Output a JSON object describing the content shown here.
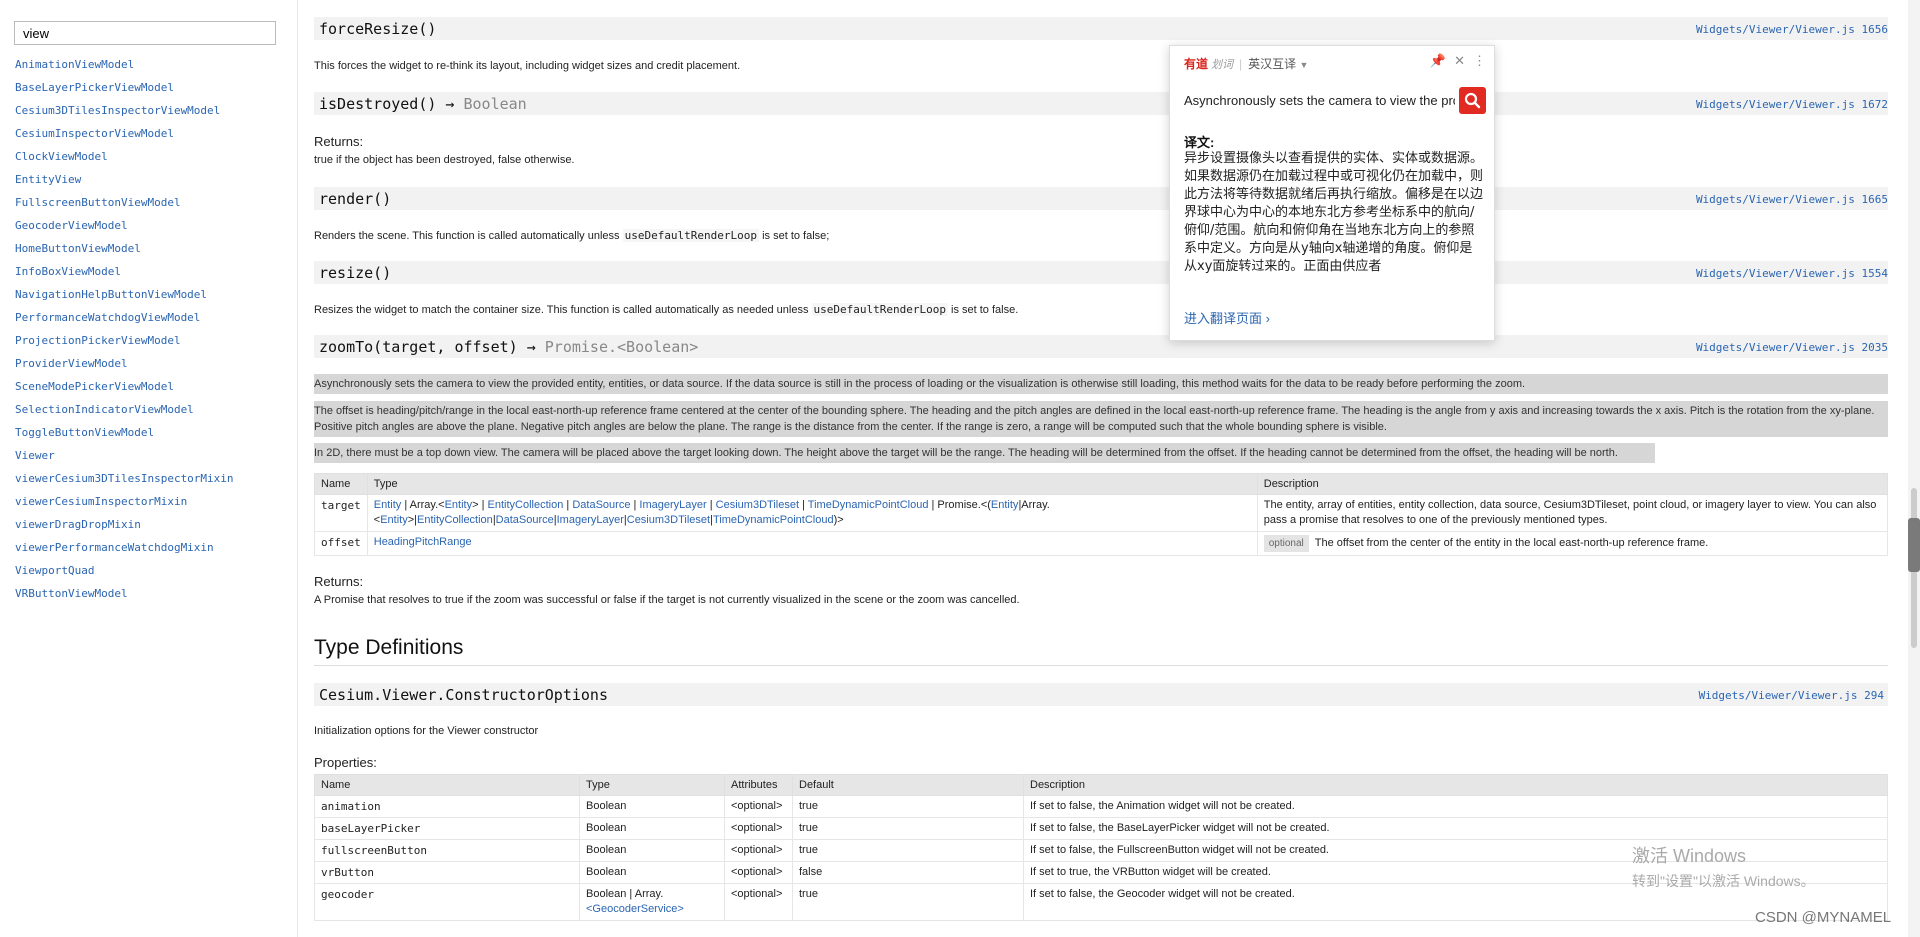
{
  "sidebar": {
    "search_value": "view",
    "items": [
      "AnimationViewModel",
      "BaseLayerPickerViewModel",
      "Cesium3DTilesInspectorViewModel",
      "CesiumInspectorViewModel",
      "ClockViewModel",
      "EntityView",
      "FullscreenButtonViewModel",
      "GeocoderViewModel",
      "HomeButtonViewModel",
      "InfoBoxViewModel",
      "NavigationHelpButtonViewModel",
      "PerformanceWatchdogViewModel",
      "ProjectionPickerViewModel",
      "ProviderViewModel",
      "SceneModePickerViewModel",
      "SelectionIndicatorViewModel",
      "ToggleButtonViewModel",
      "Viewer",
      "viewerCesium3DTilesInspectorMixin",
      "viewerCesiumInspectorMixin",
      "viewerDragDropMixin",
      "viewerPerformanceWatchdogMixin",
      "ViewportQuad",
      "VRButtonViewModel"
    ]
  },
  "methods": {
    "forceResize": {
      "signature": "forceResize()",
      "source": "Widgets/Viewer/Viewer.js 1656",
      "desc": "This forces the widget to re-think its layout, including widget sizes and credit placement."
    },
    "isDestroyed": {
      "signature": "isDestroyed()",
      "arrow": " → ",
      "returns_type": "Boolean",
      "source": "Widgets/Viewer/Viewer.js 1672",
      "returns_label": "Returns:",
      "returns_desc": "true if the object has been destroyed, false otherwise."
    },
    "render": {
      "signature": "render()",
      "source": "Widgets/Viewer/Viewer.js 1665",
      "desc_before": "Renders the scene. This function is called automatically unless ",
      "desc_code": "useDefaultRenderLoop",
      "desc_after": " is set to false;"
    },
    "resize": {
      "signature": "resize()",
      "source": "Widgets/Viewer/Viewer.js 1554",
      "desc_before": "Resizes the widget to match the container size. This function is called automatically as needed unless ",
      "desc_code": "useDefaultRenderLoop",
      "desc_after": " is set to false."
    },
    "zoomTo": {
      "signature": "zoomTo(target, offset)",
      "arrow": " → ",
      "returns_type": "Promise.<Boolean>",
      "source": "Widgets/Viewer/Viewer.js 2035",
      "p1": "Asynchronously sets the camera to view the provided entity, entities, or data source. If the data source is still in the process of loading or the visualization is otherwise still loading, this method waits for the data to be ready before performing the zoom.",
      "p2": "The offset is heading/pitch/range in the local east-north-up reference frame centered at the center of the bounding sphere. The heading and the pitch angles are defined in the local east-north-up reference frame. The heading is the angle from y axis and increasing towards the x axis. Pitch is the rotation from the xy-plane. Positive pitch angles are above the plane. Negative pitch angles are below the plane. The range is the distance from the center. If the range is zero, a range will be computed such that the whole bounding sphere is visible.",
      "p3": "In 2D, there must be a top down view. The camera will be placed above the target looking down. The height above the target will be the range. The heading will be determined from the offset. If the heading cannot be determined from the offset, the heading will be north.",
      "params_headers": [
        "Name",
        "Type",
        "Description"
      ],
      "target_name": "target",
      "target_type": {
        "t1": "Entity",
        "t2": "Array.<",
        "t3": "Entity",
        "t4": ">",
        "t5": "EntityCollection",
        "t6": "DataSource",
        "t7": "ImageryLayer",
        "t8": "Cesium3DTileset",
        "t9": "TimeDynamicPointCloud",
        "t10": "Promise.<",
        "t11": "Entity",
        "t12": "Array.",
        "t13": "<",
        "t14": "Entity",
        "t15": ">|",
        "t16": "EntityCollection",
        "t17": "DataSource",
        "t18": "ImageryLayer",
        "t19": "Cesium3DTileset",
        "t20": "TimeDynamicPointCloud",
        "t21": ")>"
      },
      "target_desc": "The entity, array of entities, entity collection, data source, Cesium3DTileset, point cloud, or imagery layer to view. You can also pass a promise that resolves to one of the previously mentioned types.",
      "offset_name": "offset",
      "offset_type": "HeadingPitchRange",
      "offset_badge": "optional",
      "offset_desc": "The offset from the center of the entity in the local east-north-up reference frame.",
      "returns_label": "Returns:",
      "returns_desc": "A Promise that resolves to true if the zoom was successful or false if the target is not currently visualized in the scene or the zoom was cancelled."
    }
  },
  "typedefs": {
    "heading": "Type Definitions",
    "ctor_signature": "Cesium.Viewer.ConstructorOptions",
    "ctor_source": "Widgets/Viewer/Viewer.js 294",
    "ctor_desc": "Initialization options for the Viewer constructor",
    "props_label": "Properties:",
    "headers": [
      "Name",
      "Type",
      "Attributes",
      "Default",
      "Description"
    ],
    "rows": [
      {
        "name": "animation",
        "type": "Boolean",
        "attr": "<optional>",
        "def": "true",
        "desc": "If set to false, the Animation widget will not be created."
      },
      {
        "name": "baseLayerPicker",
        "type": "Boolean",
        "attr": "<optional>",
        "def": "true",
        "desc": "If set to false, the BaseLayerPicker widget will not be created."
      },
      {
        "name": "fullscreenButton",
        "type": "Boolean",
        "attr": "<optional>",
        "def": "true",
        "desc": "If set to false, the FullscreenButton widget will not be created."
      },
      {
        "name": "vrButton",
        "type": "Boolean",
        "attr": "<optional>",
        "def": "false",
        "desc": "If set to true, the VRButton widget will be created."
      },
      {
        "name": "geocoder",
        "type": "Boolean | Array.",
        "type_link": "<GeocoderService>",
        "attr": "<optional>",
        "def": "true",
        "desc": "If set to false, the Geocoder widget will not be created."
      }
    ]
  },
  "popup": {
    "brand": "有道",
    "brand_sub": "划词",
    "sep": "|",
    "mode": "英汉互译",
    "caret": "▼",
    "pin_icon": "📌",
    "close_icon": "✕",
    "more_icon": "⋮",
    "input_value": "Asynchronously sets the camera to view the provided entity",
    "translation_label": "译文:",
    "translation": "异步设置摄像头以查看提供的实体、实体或数据源。如果数据源仍在加载过程中或可视化仍在加载中，则此方法将等待数据就绪后再执行缩放。偏移是在以边界球中心为中心的本地东北方参考坐标系中的航向/俯仰/范围。航向和俯仰角在当地东北方向上的参照系中定义。方向是从y轴向x轴递增的角度。俯仰是从xy面旋转过来的。正面由供应者",
    "link": "进入翻译页面 ›"
  },
  "watermarks": {
    "win_title": "激活 Windows",
    "win_sub": "转到\"设置\"以激活 Windows。",
    "csdn": "CSDN @MYNAMEL"
  },
  "colors": {
    "link": "#2b65b1",
    "param": "#b5651d",
    "youdao_red": "#e02a22"
  }
}
